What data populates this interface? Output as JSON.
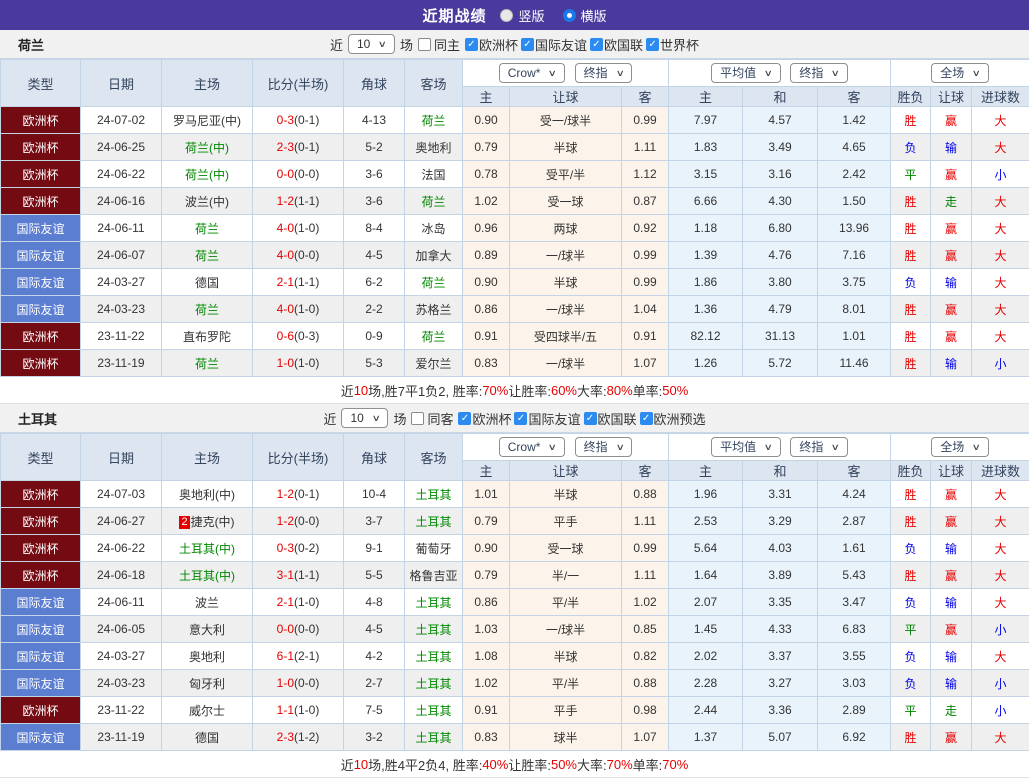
{
  "title_bar": {
    "title": "近期战绩",
    "radios": [
      {
        "label": "竖版",
        "selected": false
      },
      {
        "label": "横版",
        "selected": true
      }
    ]
  },
  "colors": {
    "accent_purple": "#4A3A9D",
    "checkbox_blue": "#2B8BF0",
    "focal_team_green": "#008800",
    "score_red": "#E60000",
    "win_red": "#E60000",
    "draw_green": "#008000",
    "lose_blue": "#0000E6"
  },
  "league_colors": {
    "欧洲杯": "#740B12",
    "国际友谊": "#5B7ED0"
  },
  "verdict_colors": {
    "胜": "#E60000",
    "平": "#008000",
    "负": "#0000E6",
    "赢": "#E60000",
    "输": "#0000E6",
    "走": "#008000",
    "大": "#E60000",
    "小": "#0000E6"
  },
  "table_controls": {
    "odds_dd": "Crow*",
    "odds_final_dd": "终指",
    "avg_dd": "平均值",
    "avg_final_dd": "终指",
    "scope_dd": "全场"
  },
  "columns": {
    "type": "类型",
    "date": "日期",
    "home": "主场",
    "score": "比分(半场)",
    "corner": "角球",
    "away": "客场",
    "odds_home": "主",
    "odds_hcap": "让球",
    "odds_away": "客",
    "avg_home": "主",
    "avg_draw": "和",
    "avg_away": "客",
    "result": "胜负",
    "hcap_result": "让球",
    "goals": "进球数"
  },
  "sections": [
    {
      "team": "荷兰",
      "filter": {
        "prefix": "近",
        "count": "10",
        "suffix": "场",
        "same_side": {
          "label": "同主",
          "checked": false
        },
        "leagues": [
          {
            "label": "欧洲杯",
            "checked": true
          },
          {
            "label": "国际友谊",
            "checked": true
          },
          {
            "label": "欧国联",
            "checked": true
          },
          {
            "label": "世界杯",
            "checked": true
          }
        ]
      },
      "rows": [
        {
          "league": "欧洲杯",
          "date": "24-07-02",
          "home": "罗马尼亚(中)",
          "home_focal": false,
          "home_badge": "",
          "score": "0-3",
          "half": "(0-1)",
          "corners": "4-13",
          "away": "荷兰",
          "away_focal": true,
          "odds": [
            "0.90",
            "受一/球半",
            "0.99"
          ],
          "avg": [
            "7.97",
            "4.57",
            "1.42"
          ],
          "result": "胜",
          "handicap": "赢",
          "goals": "大"
        },
        {
          "league": "欧洲杯",
          "date": "24-06-25",
          "home": "荷兰(中)",
          "home_focal": true,
          "home_badge": "",
          "score": "2-3",
          "half": "(0-1)",
          "corners": "5-2",
          "away": "奥地利",
          "away_focal": false,
          "odds": [
            "0.79",
            "半球",
            "1.11"
          ],
          "avg": [
            "1.83",
            "3.49",
            "4.65"
          ],
          "result": "负",
          "handicap": "输",
          "goals": "大"
        },
        {
          "league": "欧洲杯",
          "date": "24-06-22",
          "home": "荷兰(中)",
          "home_focal": true,
          "home_badge": "",
          "score": "0-0",
          "half": "(0-0)",
          "corners": "3-6",
          "away": "法国",
          "away_focal": false,
          "odds": [
            "0.78",
            "受平/半",
            "1.12"
          ],
          "avg": [
            "3.15",
            "3.16",
            "2.42"
          ],
          "result": "平",
          "handicap": "赢",
          "goals": "小"
        },
        {
          "league": "欧洲杯",
          "date": "24-06-16",
          "home": "波兰(中)",
          "home_focal": false,
          "home_badge": "",
          "score": "1-2",
          "half": "(1-1)",
          "corners": "3-6",
          "away": "荷兰",
          "away_focal": true,
          "odds": [
            "1.02",
            "受一球",
            "0.87"
          ],
          "avg": [
            "6.66",
            "4.30",
            "1.50"
          ],
          "result": "胜",
          "handicap": "走",
          "goals": "大"
        },
        {
          "league": "国际友谊",
          "date": "24-06-11",
          "home": "荷兰",
          "home_focal": true,
          "home_badge": "",
          "score": "4-0",
          "half": "(1-0)",
          "corners": "8-4",
          "away": "冰岛",
          "away_focal": false,
          "odds": [
            "0.96",
            "两球",
            "0.92"
          ],
          "avg": [
            "1.18",
            "6.80",
            "13.96"
          ],
          "result": "胜",
          "handicap": "赢",
          "goals": "大"
        },
        {
          "league": "国际友谊",
          "date": "24-06-07",
          "home": "荷兰",
          "home_focal": true,
          "home_badge": "",
          "score": "4-0",
          "half": "(0-0)",
          "corners": "4-5",
          "away": "加拿大",
          "away_focal": false,
          "odds": [
            "0.89",
            "一/球半",
            "0.99"
          ],
          "avg": [
            "1.39",
            "4.76",
            "7.16"
          ],
          "result": "胜",
          "handicap": "赢",
          "goals": "大"
        },
        {
          "league": "国际友谊",
          "date": "24-03-27",
          "home": "德国",
          "home_focal": false,
          "home_badge": "",
          "score": "2-1",
          "half": "(1-1)",
          "corners": "6-2",
          "away": "荷兰",
          "away_focal": true,
          "odds": [
            "0.90",
            "半球",
            "0.99"
          ],
          "avg": [
            "1.86",
            "3.80",
            "3.75"
          ],
          "result": "负",
          "handicap": "输",
          "goals": "大"
        },
        {
          "league": "国际友谊",
          "date": "24-03-23",
          "home": "荷兰",
          "home_focal": true,
          "home_badge": "",
          "score": "4-0",
          "half": "(1-0)",
          "corners": "2-2",
          "away": "苏格兰",
          "away_focal": false,
          "odds": [
            "0.86",
            "一/球半",
            "1.04"
          ],
          "avg": [
            "1.36",
            "4.79",
            "8.01"
          ],
          "result": "胜",
          "handicap": "赢",
          "goals": "大"
        },
        {
          "league": "欧洲杯",
          "date": "23-11-22",
          "home": "直布罗陀",
          "home_focal": false,
          "home_badge": "",
          "score": "0-6",
          "half": "(0-3)",
          "corners": "0-9",
          "away": "荷兰",
          "away_focal": true,
          "odds": [
            "0.91",
            "受四球半/五",
            "0.91"
          ],
          "avg": [
            "82.12",
            "31.13",
            "1.01"
          ],
          "result": "胜",
          "handicap": "赢",
          "goals": "大"
        },
        {
          "league": "欧洲杯",
          "date": "23-11-19",
          "home": "荷兰",
          "home_focal": true,
          "home_badge": "",
          "score": "1-0",
          "half": "(1-0)",
          "corners": "5-3",
          "away": "爱尔兰",
          "away_focal": false,
          "odds": [
            "0.83",
            "一/球半",
            "1.07"
          ],
          "avg": [
            "1.26",
            "5.72",
            "11.46"
          ],
          "result": "胜",
          "handicap": "输",
          "goals": "小"
        }
      ],
      "summary": [
        {
          "t": "近",
          "red": false
        },
        {
          "t": "10",
          "red": true
        },
        {
          "t": "场,胜7平1负2, 胜率:",
          "red": false
        },
        {
          "t": "70%",
          "red": true
        },
        {
          "t": " 让胜率:",
          "red": false
        },
        {
          "t": "60%",
          "red": true
        },
        {
          "t": " 大率:",
          "red": false
        },
        {
          "t": "80%",
          "red": true
        },
        {
          "t": " 单率:",
          "red": false
        },
        {
          "t": "50%",
          "red": true
        }
      ]
    },
    {
      "team": "土耳其",
      "filter": {
        "prefix": "近",
        "count": "10",
        "suffix": "场",
        "same_side": {
          "label": "同客",
          "checked": false
        },
        "leagues": [
          {
            "label": "欧洲杯",
            "checked": true
          },
          {
            "label": "国际友谊",
            "checked": true
          },
          {
            "label": "欧国联",
            "checked": true
          },
          {
            "label": "欧洲预选",
            "checked": true
          }
        ]
      },
      "rows": [
        {
          "league": "欧洲杯",
          "date": "24-07-03",
          "home": "奥地利(中)",
          "home_focal": false,
          "home_badge": "",
          "score": "1-2",
          "half": "(0-1)",
          "corners": "10-4",
          "away": "土耳其",
          "away_focal": true,
          "odds": [
            "1.01",
            "半球",
            "0.88"
          ],
          "avg": [
            "1.96",
            "3.31",
            "4.24"
          ],
          "result": "胜",
          "handicap": "赢",
          "goals": "大"
        },
        {
          "league": "欧洲杯",
          "date": "24-06-27",
          "home": "捷克(中)",
          "home_focal": false,
          "home_badge": "2",
          "score": "1-2",
          "half": "(0-0)",
          "corners": "3-7",
          "away": "土耳其",
          "away_focal": true,
          "odds": [
            "0.79",
            "平手",
            "1.11"
          ],
          "avg": [
            "2.53",
            "3.29",
            "2.87"
          ],
          "result": "胜",
          "handicap": "赢",
          "goals": "大"
        },
        {
          "league": "欧洲杯",
          "date": "24-06-22",
          "home": "土耳其(中)",
          "home_focal": true,
          "home_badge": "",
          "score": "0-3",
          "half": "(0-2)",
          "corners": "9-1",
          "away": "葡萄牙",
          "away_focal": false,
          "odds": [
            "0.90",
            "受一球",
            "0.99"
          ],
          "avg": [
            "5.64",
            "4.03",
            "1.61"
          ],
          "result": "负",
          "handicap": "输",
          "goals": "大"
        },
        {
          "league": "欧洲杯",
          "date": "24-06-18",
          "home": "土耳其(中)",
          "home_focal": true,
          "home_badge": "",
          "score": "3-1",
          "half": "(1-1)",
          "corners": "5-5",
          "away": "格鲁吉亚",
          "away_focal": false,
          "odds": [
            "0.79",
            "半/一",
            "1.11"
          ],
          "avg": [
            "1.64",
            "3.89",
            "5.43"
          ],
          "result": "胜",
          "handicap": "赢",
          "goals": "大"
        },
        {
          "league": "国际友谊",
          "date": "24-06-11",
          "home": "波兰",
          "home_focal": false,
          "home_badge": "",
          "score": "2-1",
          "half": "(1-0)",
          "corners": "4-8",
          "away": "土耳其",
          "away_focal": true,
          "odds": [
            "0.86",
            "平/半",
            "1.02"
          ],
          "avg": [
            "2.07",
            "3.35",
            "3.47"
          ],
          "result": "负",
          "handicap": "输",
          "goals": "大"
        },
        {
          "league": "国际友谊",
          "date": "24-06-05",
          "home": "意大利",
          "home_focal": false,
          "home_badge": "",
          "score": "0-0",
          "half": "(0-0)",
          "corners": "4-5",
          "away": "土耳其",
          "away_focal": true,
          "odds": [
            "1.03",
            "一/球半",
            "0.85"
          ],
          "avg": [
            "1.45",
            "4.33",
            "6.83"
          ],
          "result": "平",
          "handicap": "赢",
          "goals": "小"
        },
        {
          "league": "国际友谊",
          "date": "24-03-27",
          "home": "奥地利",
          "home_focal": false,
          "home_badge": "",
          "score": "6-1",
          "half": "(2-1)",
          "corners": "4-2",
          "away": "土耳其",
          "away_focal": true,
          "odds": [
            "1.08",
            "半球",
            "0.82"
          ],
          "avg": [
            "2.02",
            "3.37",
            "3.55"
          ],
          "result": "负",
          "handicap": "输",
          "goals": "大"
        },
        {
          "league": "国际友谊",
          "date": "24-03-23",
          "home": "匈牙利",
          "home_focal": false,
          "home_badge": "",
          "score": "1-0",
          "half": "(0-0)",
          "corners": "2-7",
          "away": "土耳其",
          "away_focal": true,
          "odds": [
            "1.02",
            "平/半",
            "0.88"
          ],
          "avg": [
            "2.28",
            "3.27",
            "3.03"
          ],
          "result": "负",
          "handicap": "输",
          "goals": "小"
        },
        {
          "league": "欧洲杯",
          "date": "23-11-22",
          "home": "威尔士",
          "home_focal": false,
          "home_badge": "",
          "score": "1-1",
          "half": "(1-0)",
          "corners": "7-5",
          "away": "土耳其",
          "away_focal": true,
          "odds": [
            "0.91",
            "平手",
            "0.98"
          ],
          "avg": [
            "2.44",
            "3.36",
            "2.89"
          ],
          "result": "平",
          "handicap": "走",
          "goals": "小"
        },
        {
          "league": "国际友谊",
          "date": "23-11-19",
          "home": "德国",
          "home_focal": false,
          "home_badge": "",
          "score": "2-3",
          "half": "(1-2)",
          "corners": "3-2",
          "away": "土耳其",
          "away_focal": true,
          "odds": [
            "0.83",
            "球半",
            "1.07"
          ],
          "avg": [
            "1.37",
            "5.07",
            "6.92"
          ],
          "result": "胜",
          "handicap": "赢",
          "goals": "大"
        }
      ],
      "summary": [
        {
          "t": "近",
          "red": false
        },
        {
          "t": "10",
          "red": true
        },
        {
          "t": "场,胜4平2负4, 胜率:",
          "red": false
        },
        {
          "t": "40%",
          "red": true
        },
        {
          "t": " 让胜率:",
          "red": false
        },
        {
          "t": "50%",
          "red": true
        },
        {
          "t": " 大率:",
          "red": false
        },
        {
          "t": "70%",
          "red": true
        },
        {
          "t": " 单率:",
          "red": false
        },
        {
          "t": "70%",
          "red": true
        }
      ]
    }
  ]
}
